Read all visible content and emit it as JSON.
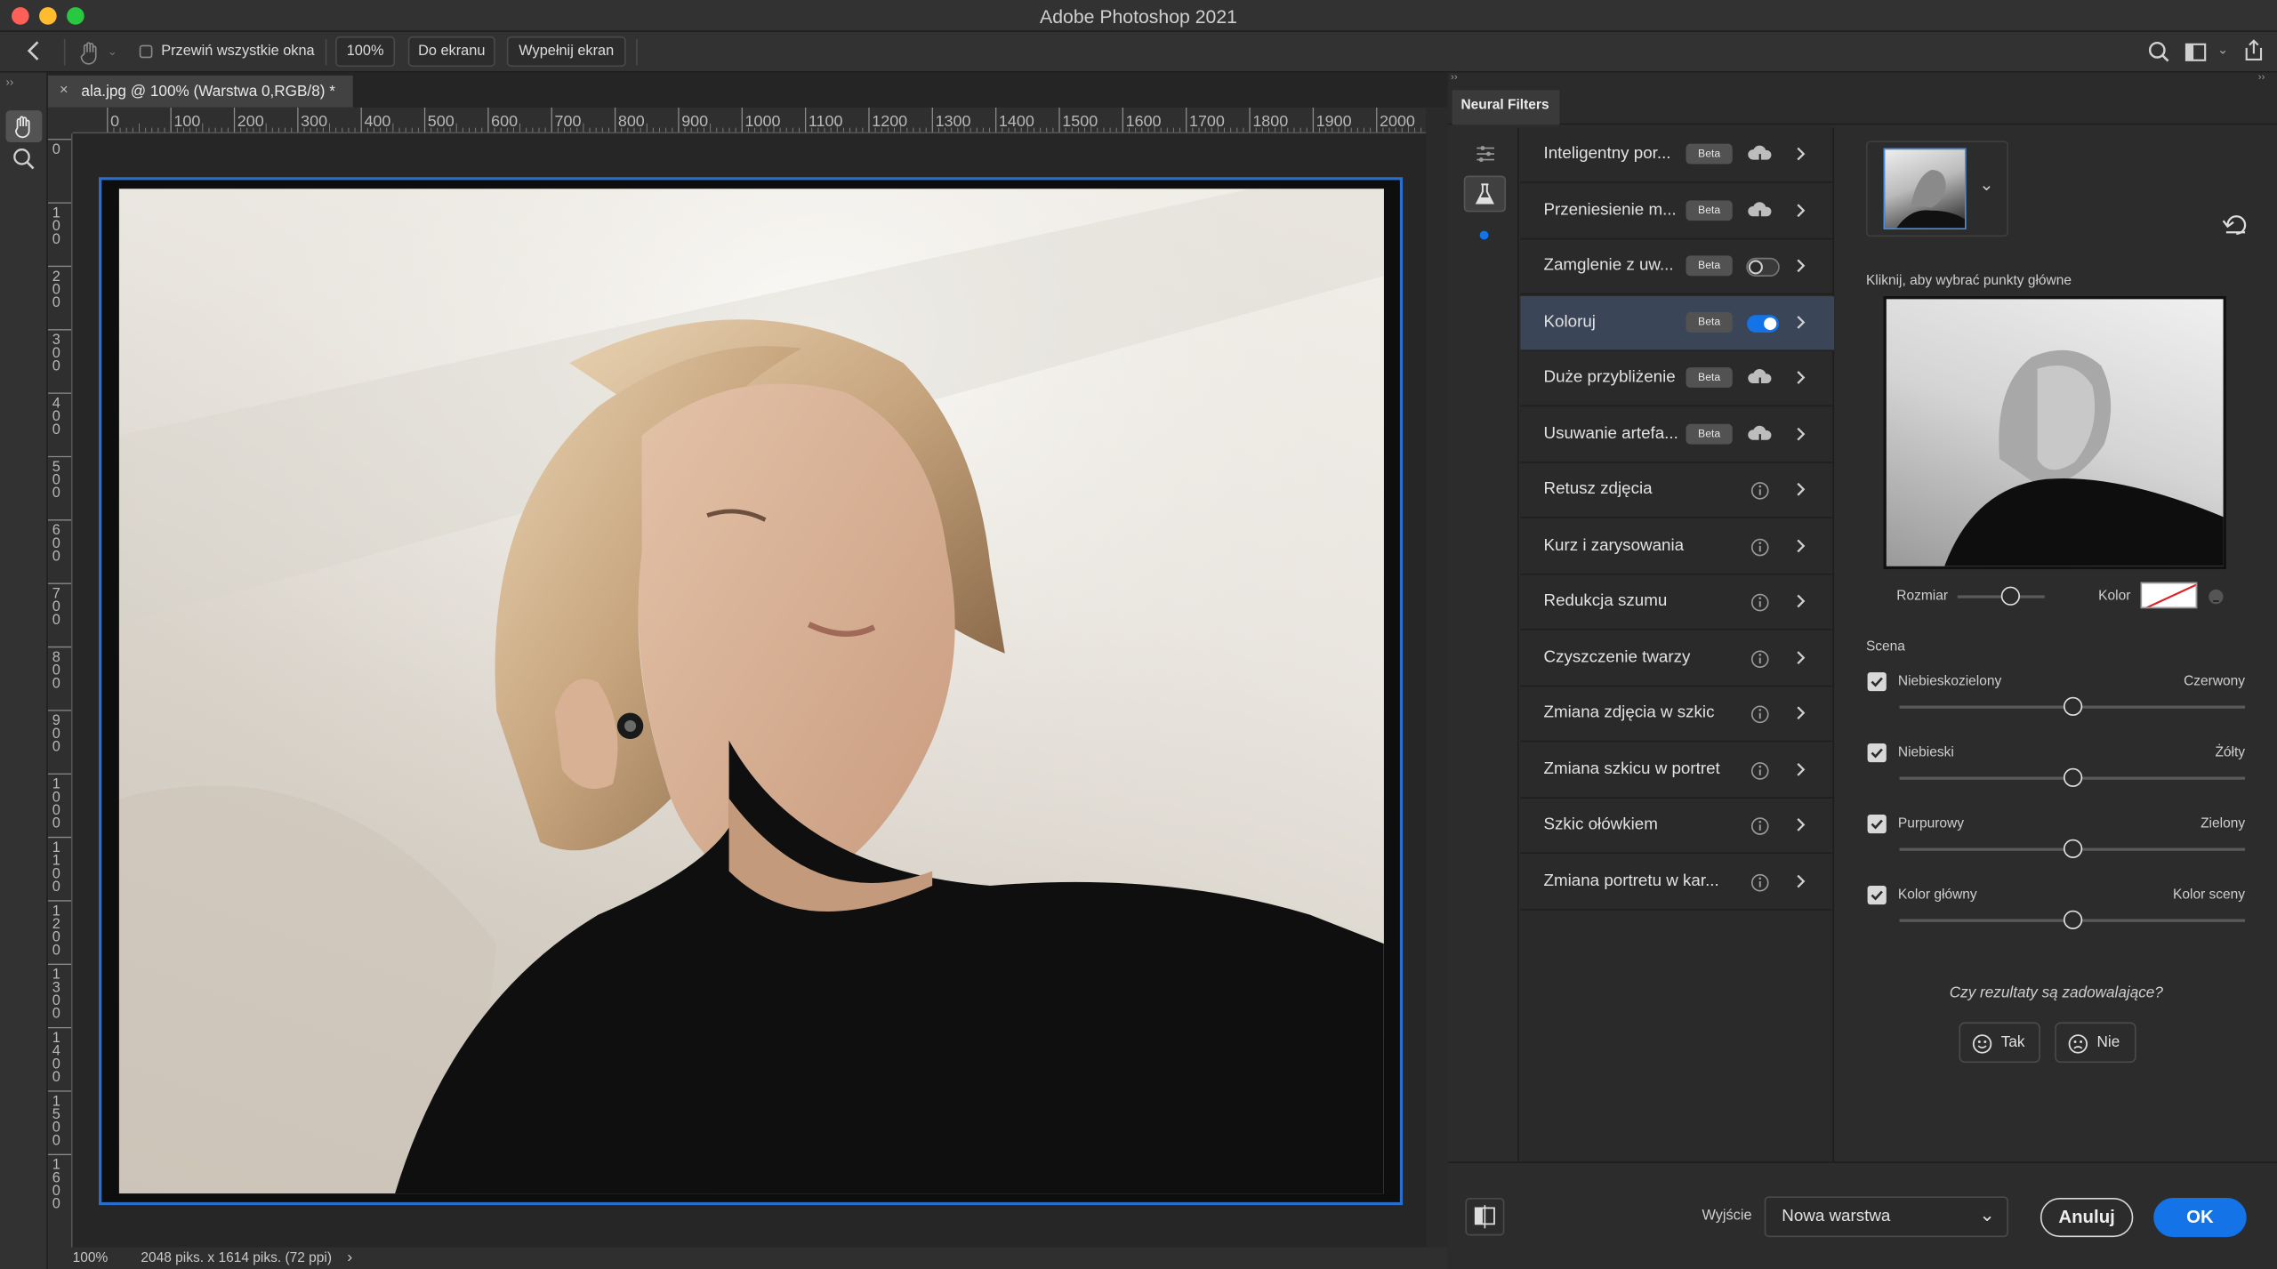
{
  "window": {
    "title": "Adobe Photoshop 2021"
  },
  "options_bar": {
    "scroll_all_label": "Przewiń wszystkie okna",
    "zoom_button": "100%",
    "fit_screen_button": "Do ekranu",
    "fill_screen_button": "Wypełnij ekran"
  },
  "document": {
    "tab_title": "ala.jpg @ 100% (Warstwa 0,RGB/8) *",
    "ruler_h": [
      "0",
      "100",
      "200",
      "300",
      "400",
      "500",
      "600",
      "700",
      "800",
      "900",
      "1000",
      "1100",
      "1200",
      "1300",
      "1400",
      "1500",
      "1600",
      "1700",
      "1800",
      "1900",
      "2000"
    ],
    "ruler_v": [
      "0",
      "100",
      "200",
      "300",
      "400",
      "500",
      "600",
      "700",
      "800",
      "900",
      "1000",
      "1100",
      "1200",
      "1300",
      "1400",
      "1500",
      "1600"
    ],
    "status_zoom": "100%",
    "status_info": "2048 piks. x 1614 piks. (72 ppi)"
  },
  "neural_filters": {
    "tab_label": "Neural Filters",
    "filters": [
      {
        "label": "Inteligentny por...",
        "beta": "Beta",
        "icon": "cloud-download-icon"
      },
      {
        "label": "Przeniesienie m...",
        "beta": "Beta",
        "icon": "cloud-download-icon"
      },
      {
        "label": "Zamglenie z uw...",
        "beta": "Beta",
        "icon": "toggle-off-icon"
      },
      {
        "label": "Koloruj",
        "beta": "Beta",
        "icon": "toggle-on-icon",
        "selected": true
      },
      {
        "label": "Duże przybliżenie",
        "beta": "Beta",
        "icon": "cloud-download-icon"
      },
      {
        "label": "Usuwanie artefa...",
        "beta": "Beta",
        "icon": "cloud-download-icon"
      },
      {
        "label": "Retusz zdjęcia",
        "icon": "info-icon"
      },
      {
        "label": "Kurz i zarysowania",
        "icon": "info-icon"
      },
      {
        "label": "Redukcja szumu",
        "icon": "info-icon"
      },
      {
        "label": "Czyszczenie twarzy",
        "icon": "info-icon"
      },
      {
        "label": "Zmiana zdjęcia w szkic",
        "icon": "info-icon"
      },
      {
        "label": "Zmiana szkicu w portret",
        "icon": "info-icon"
      },
      {
        "label": "Szkic ołówkiem",
        "icon": "info-icon"
      },
      {
        "label": "Zmiana portretu w kar...",
        "icon": "info-icon"
      }
    ],
    "detail": {
      "instruction": "Kliknij, aby wybrać punkty główne",
      "size_label": "Rozmiar",
      "color_label": "Kolor",
      "size_value": 0.6,
      "scene_label": "Scena",
      "sliders": [
        {
          "left": "Niebieskozielony",
          "right": "Czerwony",
          "value": 0.5,
          "checked": true
        },
        {
          "left": "Niebieski",
          "right": "Żółty",
          "value": 0.5,
          "checked": true
        },
        {
          "left": "Purpurowy",
          "right": "Zielony",
          "value": 0.5,
          "checked": true
        },
        {
          "left": "Kolor główny",
          "right": "Kolor sceny",
          "value": 0.5,
          "checked": true
        }
      ],
      "feedback_question": "Czy rezultaty są zadowalające?",
      "yes_button": "Tak",
      "no_button": "Nie"
    },
    "footer": {
      "output_label": "Wyjście",
      "output_value": "Nowa warstwa",
      "cancel_button": "Anuluj",
      "ok_button": "OK"
    }
  },
  "colors": {
    "accent": "#1473e6",
    "selection": "#3b4558",
    "frame": "#2a6fd0"
  }
}
